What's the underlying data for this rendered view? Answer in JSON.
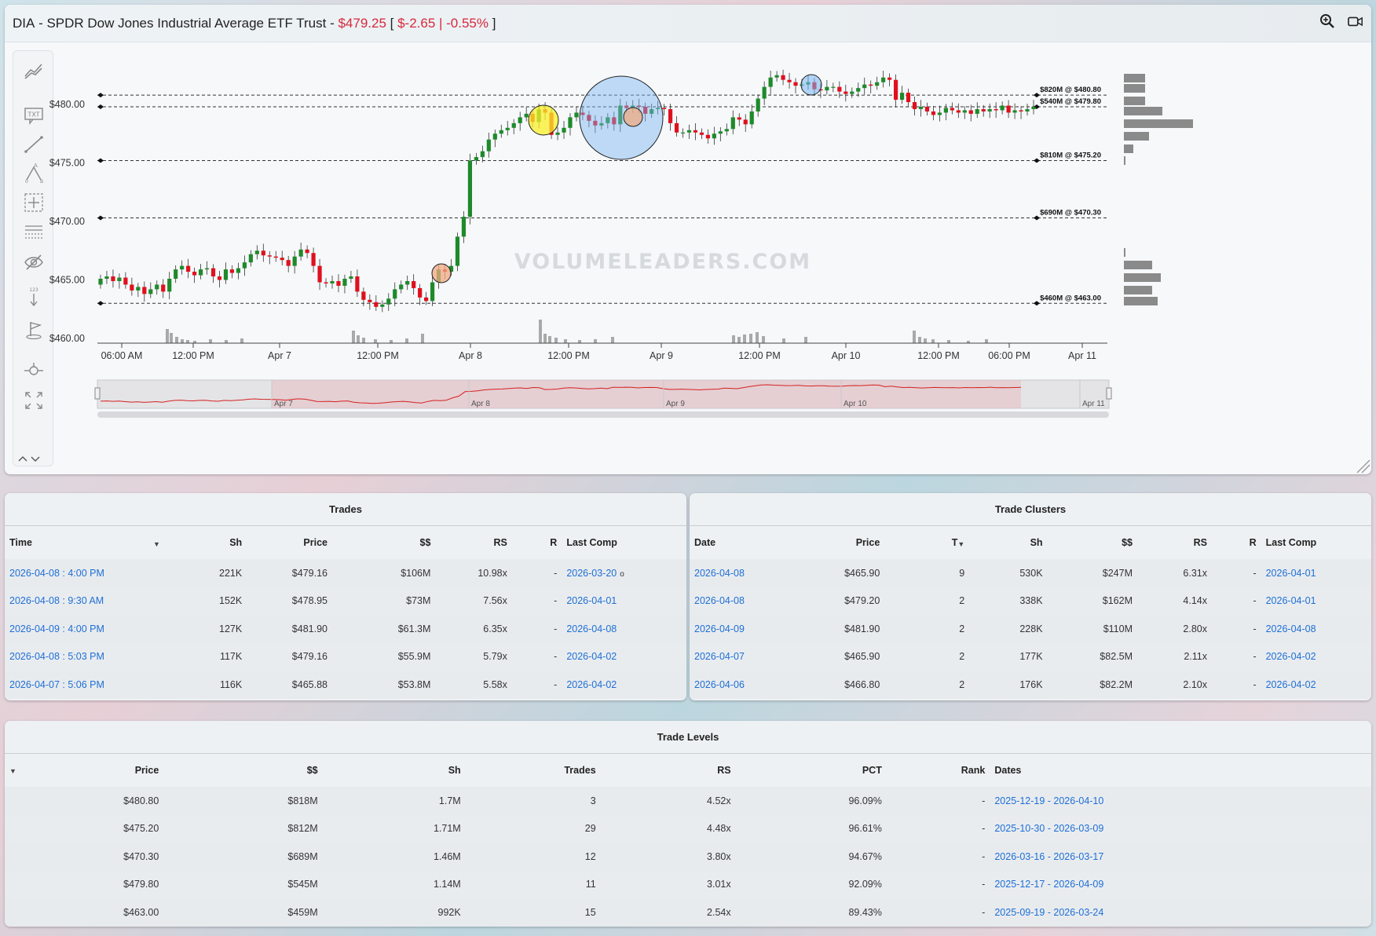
{
  "header": {
    "ticker": "DIA",
    "separator": " - ",
    "name": "SPDR Dow Jones Industrial Average ETF Trust",
    "dash": " - ",
    "price": "$479.25",
    "open_bracket": " [ ",
    "change": "$-2.65 | -0.55%",
    "close_bracket": " ]",
    "icons": [
      "zoom-in-icon",
      "video-camera-icon"
    ]
  },
  "toolbar": {
    "tools": [
      "trend-lines-icon",
      "text-tool-icon",
      "line-tool-icon",
      "measure-ab-icon",
      "crosshair-box-icon",
      "fibonacci-lines-icon",
      "hide-drawings-icon",
      "price-marker-icon",
      "flag-icon",
      "zoom-pan-icon",
      "fullscreen-icon"
    ],
    "txt_label": "TXT",
    "scale_label": "123"
  },
  "chart_data": {
    "type": "candlestick",
    "title": "",
    "watermark": "VOLUMELEADERS.COM",
    "y_ticks": [
      "$480.00",
      "$475.00",
      "$470.00",
      "$465.00",
      "$460.00"
    ],
    "y_values": [
      480,
      475,
      470,
      465,
      460
    ],
    "ylim": [
      460,
      484
    ],
    "x_ticks": [
      "06:00 AM",
      "12:00 PM",
      "Apr 7",
      "12:00 PM",
      "Apr 8",
      "12:00 PM",
      "Apr 9",
      "12:00 PM",
      "Apr 10",
      "12:00 PM",
      "06:00 PM",
      "Apr 11"
    ],
    "navigator_labels": [
      "Apr 7",
      "Apr 8",
      "Apr 9",
      "Apr 10",
      "Apr 11"
    ],
    "levels": [
      {
        "label": "$820M @ $480.80",
        "price": 480.8
      },
      {
        "label": "$540M @ $479.80",
        "price": 479.8
      },
      {
        "label": "$810M @ $475.20",
        "price": 475.2
      },
      {
        "label": "$690M @ $470.30",
        "price": 470.3
      },
      {
        "label": "$460M @ $463.00",
        "price": 463.0
      }
    ],
    "close_path": [
      465.1,
      465.3,
      464.9,
      465.2,
      464.6,
      464.1,
      464.4,
      463.8,
      464.2,
      464.6,
      464.0,
      465.1,
      465.9,
      466.2,
      465.7,
      465.4,
      465.9,
      466.0,
      465.3,
      465.0,
      465.9,
      465.6,
      466.0,
      466.5,
      467.2,
      467.5,
      467.1,
      467.0,
      466.9,
      466.7,
      466.2,
      467.0,
      467.6,
      467.3,
      466.2,
      464.8,
      464.7,
      464.9,
      464.5,
      465.1,
      465.3,
      464.0,
      463.3,
      463.1,
      462.7,
      462.9,
      463.4,
      464.2,
      464.6,
      464.9,
      464.3,
      463.5,
      463.2,
      464.8,
      465.9,
      465.7,
      466.2,
      468.7,
      470.4,
      475.2,
      475.5,
      476.0,
      477.0,
      477.5,
      477.8,
      478.0,
      478.4,
      478.9,
      479.2,
      478.5,
      479.6,
      479.3,
      477.4,
      477.6,
      478.0,
      478.9,
      479.3,
      479.1,
      478.6,
      478.2,
      478.4,
      478.9,
      478.3,
      479.9,
      479.7,
      479.9,
      479.8,
      479.2,
      479.6,
      479.7,
      479.6,
      478.4,
      477.6,
      477.6,
      477.8,
      477.6,
      477.4,
      477.1,
      477.5,
      477.7,
      477.9,
      478.9,
      478.7,
      478.3,
      479.4,
      480.5,
      481.5,
      482.3,
      482.5,
      482.1,
      481.9,
      481.6,
      481.7,
      481.9,
      481.3,
      481.2,
      481.5,
      481.5,
      481.1,
      480.9,
      481.1,
      481.4,
      481.7,
      481.6,
      481.9,
      482.3,
      482.1,
      480.4,
      481.0,
      480.2,
      479.6,
      479.8,
      479.4,
      479.1,
      479.3,
      479.7,
      479.5,
      479.3,
      479.5,
      479.2,
      479.6,
      479.4,
      479.6,
      479.5,
      479.9,
      479.3,
      479.5,
      479.4,
      479.6,
      479.8
    ]
  },
  "trades": {
    "title": "Trades",
    "columns": [
      "Time",
      "Sh",
      "Price",
      "$$",
      "RS",
      "R",
      "Last Comp"
    ],
    "rows": [
      [
        "2026-04-08 : 4:00 PM",
        "221K",
        "$479.16",
        "$106M",
        "10.98x",
        "-",
        "2026-03-20"
      ],
      [
        "2026-04-08 : 9:30 AM",
        "152K",
        "$478.95",
        "$73M",
        "7.56x",
        "-",
        "2026-04-01"
      ],
      [
        "2026-04-09 : 4:00 PM",
        "127K",
        "$481.90",
        "$61.3M",
        "6.35x",
        "-",
        "2026-04-08"
      ],
      [
        "2026-04-08 : 5:03 PM",
        "117K",
        "$479.16",
        "$55.9M",
        "5.79x",
        "-",
        "2026-04-02"
      ],
      [
        "2026-04-07 : 5:06 PM",
        "116K",
        "$465.88",
        "$53.8M",
        "5.58x",
        "-",
        "2026-04-02"
      ]
    ],
    "first_row_suffix": "o"
  },
  "clusters": {
    "title": "Trade Clusters",
    "columns": [
      "Date",
      "Price",
      "T",
      "Sh",
      "$$",
      "RS",
      "R",
      "Last Comp"
    ],
    "rows": [
      [
        "2026-04-08",
        "$465.90",
        "9",
        "530K",
        "$247M",
        "6.31x",
        "-",
        "2026-04-01"
      ],
      [
        "2026-04-08",
        "$479.20",
        "2",
        "338K",
        "$162M",
        "4.14x",
        "-",
        "2026-04-01"
      ],
      [
        "2026-04-09",
        "$481.90",
        "2",
        "228K",
        "$110M",
        "2.80x",
        "-",
        "2026-04-08"
      ],
      [
        "2026-04-07",
        "$465.90",
        "2",
        "177K",
        "$82.5M",
        "2.11x",
        "-",
        "2026-04-02"
      ],
      [
        "2026-04-06",
        "$466.80",
        "2",
        "176K",
        "$82.2M",
        "2.10x",
        "-",
        "2026-04-02"
      ]
    ]
  },
  "levels": {
    "title": "Trade Levels",
    "columns": [
      "Price",
      "$$",
      "Sh",
      "Trades",
      "RS",
      "PCT",
      "Rank",
      "Dates"
    ],
    "rows": [
      [
        "$480.80",
        "$818M",
        "1.7M",
        "3",
        "4.52x",
        "96.09%",
        "-",
        "2025-12-19 - 2026-04-10"
      ],
      [
        "$475.20",
        "$812M",
        "1.71M",
        "29",
        "4.48x",
        "96.61%",
        "-",
        "2025-10-30 - 2026-03-09"
      ],
      [
        "$470.30",
        "$689M",
        "1.46M",
        "12",
        "3.80x",
        "94.67%",
        "-",
        "2026-03-16 - 2026-03-17"
      ],
      [
        "$479.80",
        "$545M",
        "1.14M",
        "11",
        "3.01x",
        "92.09%",
        "-",
        "2025-12-17 - 2026-04-09"
      ],
      [
        "$463.00",
        "$459M",
        "992K",
        "15",
        "2.54x",
        "89.43%",
        "-",
        "2025-09-19 - 2026-03-24"
      ]
    ]
  },
  "colors": {
    "up": "#1e8a2a",
    "down": "#e0101e",
    "negative_text": "#d8283b",
    "link": "#1e6fd6"
  }
}
